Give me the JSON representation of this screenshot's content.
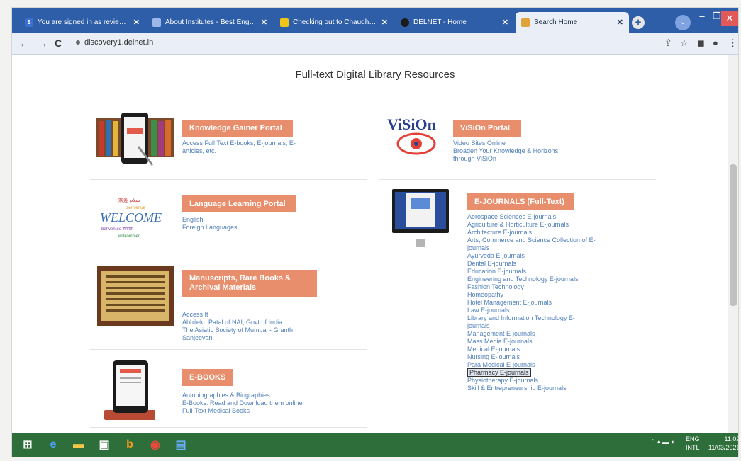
{
  "browser": {
    "tabs": [
      {
        "title": "You are signed in as reviewer",
        "favicon_color": "#3b6fd1",
        "active": false
      },
      {
        "title": "About Institutes - Best Engineering",
        "favicon_color": "#9db8e8",
        "active": false
      },
      {
        "title": "Checking out to Chaudhari S...",
        "favicon_color": "#f0c419",
        "active": false
      },
      {
        "title": "DELNET - Home",
        "favicon_color": "#1b1b1b",
        "active": false
      },
      {
        "title": "Search Home",
        "favicon_color": "#e0a23b",
        "active": true
      }
    ],
    "url": "discovery1.delnet.in",
    "new_tab_label": "+",
    "window_controls": {
      "minimize": "–",
      "maximize": "❐",
      "close": "✕"
    }
  },
  "page": {
    "heading": "Full-text Digital Library Resources",
    "sections": {
      "knowledge_gainer": {
        "title": "Knowledge Gainer Portal",
        "lines": [
          "Access Full Text E-books, E-journals, E-",
          "articles, etc."
        ]
      },
      "vision": {
        "title": "ViSiOn Portal",
        "logo_text": "ViSiOn",
        "lines": [
          "Video Sites Online",
          "Broaden Your Knowledge & Horizons",
          "through ViSiOn"
        ]
      },
      "language": {
        "title": "Language Learning Portal",
        "logo_text": "WELCOME",
        "lines": [
          "English",
          "Foreign Languages"
        ]
      },
      "ejournals": {
        "title": "E-JOURNALS (Full-Text)",
        "items": [
          "Aerospace Sciences E-journals",
          "Agriculture & Horticulture E-journals",
          "Architecture E-journals",
          "Arts, Commerce and Science Collection of E-",
          "journals",
          "Ayurveda E-journals",
          "Dental E-journals",
          "Education E-journals",
          "Engineering and Technology E-journals",
          "Fashion Technology",
          "Homeopathy",
          "Hotel Management E-journals",
          "Law E-journals",
          "Library and Information Technology E-",
          "journals",
          "Management E-journals",
          "Mass Media E-journals",
          "Medical E-journals",
          "Nursing E-journals",
          "Para Medical E-journals",
          "Pharmacy E-journals",
          "Physiotherapy E-journals",
          "Skill & Entrepreneurship E-journals"
        ],
        "highlighted_index": 20
      },
      "manuscripts": {
        "title": "Manuscripts, Rare Books & Archival Materials",
        "lines": [
          "Access It",
          "Abhilekh Patal of NAI, Govt of India",
          "The Asiatic Society of Mumbai - Granth",
          "Sanjeevani"
        ]
      },
      "ebooks": {
        "title": "E-BOOKS",
        "lines": [
          "Autobiographies & Biographies",
          "E-Books: Read and Download them online",
          "Full-Text Medical Books"
        ]
      }
    }
  },
  "taskbar": {
    "items": [
      "start-icon",
      "edge-icon",
      "file-explorer-icon",
      "store-icon",
      "bing-icon",
      "chrome-icon",
      "notepad-icon"
    ],
    "language": "ENG",
    "region": "INTL",
    "time": "11:02",
    "date": "11/03/2021"
  },
  "colors": {
    "accent_label": "#e88e6c",
    "link": "#4f7fb8",
    "tabbar": "#2f5ea8",
    "taskbar": "#2d6e3b"
  }
}
